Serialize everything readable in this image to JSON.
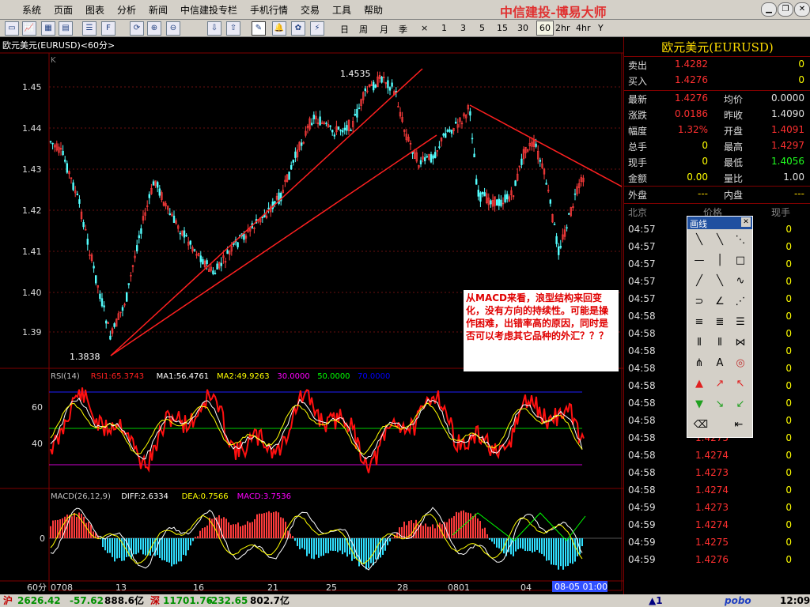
{
  "menu": {
    "items": [
      "系统",
      "页面",
      "图表",
      "分析",
      "新闻",
      "中信建投专栏",
      "手机行情",
      "交易",
      "工具",
      "帮助"
    ],
    "brand": "中信建投-博易大师"
  },
  "window_controls": [
    "minimize",
    "restore",
    "close"
  ],
  "toolbar": {
    "icons": [
      "new-window-icon",
      "line-chart-icon",
      "indicator-icon",
      "table-icon",
      "list-icon",
      "f10-icon",
      "refresh-icon",
      "zoom-in-icon",
      "zoom-out-icon",
      "export-icon",
      "import-icon",
      "draw-tool-icon",
      "alert-bell-icon",
      "colors-icon",
      "lightning-icon"
    ],
    "periods": [
      "日",
      "周",
      "月",
      "季",
      "×",
      "1",
      "3",
      "5",
      "15",
      "30",
      "60",
      "2hr",
      "4hr",
      "Y"
    ],
    "active_period": "60"
  },
  "chart": {
    "title": "欧元美元(EURUSD)<60分>",
    "price_label": "K",
    "price_ticks": [
      "1.45",
      "1.44",
      "1.43",
      "1.42",
      "1.41",
      "1.40",
      "1.39"
    ],
    "high_label": "1.4535",
    "low_label": "1.3838",
    "rsi": {
      "header": [
        {
          "text": "RSI(14)",
          "color": "#c0c0c0"
        },
        {
          "text": "RSI1:65.3743",
          "color": "#ff2020"
        },
        {
          "text": "MA1:56.4761",
          "color": "#ffffff"
        },
        {
          "text": "MA2:49.9263",
          "color": "#ffff00"
        },
        {
          "text": "30.0000",
          "color": "#ff00ff"
        },
        {
          "text": "50.0000",
          "color": "#00ff00"
        },
        {
          "text": "70.0000",
          "color": "#0000ff"
        }
      ],
      "ticks": [
        "60",
        "40"
      ]
    },
    "macd": {
      "header": [
        {
          "text": "MACD(26,12,9)",
          "color": "#c0c0c0"
        },
        {
          "text": "DIFF:2.6334",
          "color": "#ffffff"
        },
        {
          "text": "DEA:0.7566",
          "color": "#ffff00"
        },
        {
          "text": "MACD:3.7536",
          "color": "#ff00ff"
        }
      ],
      "ticks": [
        "0"
      ]
    },
    "period_label": "60分",
    "x_labels": [
      "0708",
      "13",
      "16",
      "21",
      "25",
      "28",
      "0801",
      "04"
    ],
    "cursor_time": "08-05 01:00",
    "annotation": "从MACD来看，浪型结构来回变化，没有方向的持续性。可能是操作困难，出错率高的原因，同时是否可以考虑其它品种的外汇？？？"
  },
  "quote": {
    "title": "欧元美元(EURUSD)",
    "rows_top": [
      {
        "label": "卖出",
        "value": "1.4282",
        "value_color": "#ff3030",
        "vol": "0"
      },
      {
        "label": "买入",
        "value": "1.4276",
        "value_color": "#ff3030",
        "vol": "0"
      }
    ],
    "rows_main": [
      {
        "l1": "最新",
        "v1": "1.4276",
        "c1": "#ff3030",
        "l2": "均价",
        "v2": "0.0000",
        "c2": "#e0e0e0"
      },
      {
        "l1": "涨跌",
        "v1": "0.0186",
        "c1": "#ff3030",
        "l2": "昨收",
        "v2": "1.4090",
        "c2": "#e0e0e0"
      },
      {
        "l1": "幅度",
        "v1": "1.32%",
        "c1": "#ff3030",
        "l2": "开盘",
        "v2": "1.4091",
        "c2": "#ff3030"
      },
      {
        "l1": "总手",
        "v1": "0",
        "c1": "#ffff00",
        "l2": "最高",
        "v2": "1.4297",
        "c2": "#ff3030"
      },
      {
        "l1": "现手",
        "v1": "0",
        "c1": "#ffff00",
        "l2": "最低",
        "v2": "1.4056",
        "c2": "#20ff20"
      },
      {
        "l1": "金额",
        "v1": "0.00",
        "c1": "#ffff00",
        "l2": "量比",
        "v2": "1.00",
        "c2": "#e0e0e0"
      }
    ],
    "outer_label": "外盘",
    "outer_value": "---",
    "inner_label": "内盘",
    "inner_value": "---",
    "trade_header": {
      "time": "北京",
      "price": "价格",
      "vol": "现手"
    },
    "trades": [
      {
        "time": "04:57",
        "price": "",
        "vol": "0"
      },
      {
        "time": "04:57",
        "price": "",
        "vol": "0"
      },
      {
        "time": "04:57",
        "price": "",
        "vol": "0"
      },
      {
        "time": "04:57",
        "price": "",
        "vol": "0"
      },
      {
        "time": "04:57",
        "price": "",
        "vol": "0"
      },
      {
        "time": "04:58",
        "price": "",
        "vol": "0"
      },
      {
        "time": "04:58",
        "price": "",
        "vol": "0"
      },
      {
        "time": "04:58",
        "price": "",
        "vol": "0"
      },
      {
        "time": "04:58",
        "price": "",
        "vol": "0"
      },
      {
        "time": "04:58",
        "price": "",
        "vol": "0"
      },
      {
        "time": "04:58",
        "price": "",
        "vol": "0"
      },
      {
        "time": "04:58",
        "price": "1.4276",
        "vol": "0"
      },
      {
        "time": "04:58",
        "price": "1.4275",
        "vol": "0"
      },
      {
        "time": "04:58",
        "price": "1.4274",
        "vol": "0"
      },
      {
        "time": "04:58",
        "price": "1.4273",
        "vol": "0"
      },
      {
        "time": "04:58",
        "price": "1.4274",
        "vol": "0"
      },
      {
        "time": "04:59",
        "price": "1.4273",
        "vol": "0"
      },
      {
        "time": "04:59",
        "price": "1.4274",
        "vol": "0"
      },
      {
        "time": "04:59",
        "price": "1.4275",
        "vol": "0"
      },
      {
        "time": "04:59",
        "price": "1.4276",
        "vol": "0"
      }
    ]
  },
  "drawing_tools": {
    "title": "画线",
    "tools": [
      {
        "name": "line-down-tool-icon",
        "glyph": "╲"
      },
      {
        "name": "line-down-steep-tool-icon",
        "glyph": "╲"
      },
      {
        "name": "double-line-tool-icon",
        "glyph": "⋱"
      },
      {
        "name": "horizontal-line-tool-icon",
        "glyph": "—"
      },
      {
        "name": "vertical-line-tool-icon",
        "glyph": "│"
      },
      {
        "name": "rectangle-tool-icon",
        "glyph": "□"
      },
      {
        "name": "ray-tool-icon",
        "glyph": "╱"
      },
      {
        "name": "segment-tool-icon",
        "glyph": "╲"
      },
      {
        "name": "wave-tool-icon",
        "glyph": "∿"
      },
      {
        "name": "arc-tool-icon",
        "glyph": "⊃"
      },
      {
        "name": "angle-tool-icon",
        "glyph": "∠"
      },
      {
        "name": "fan-tool-icon",
        "glyph": "⋰"
      },
      {
        "name": "channel-tool-icon",
        "glyph": "≡"
      },
      {
        "name": "parallel-tool-icon",
        "glyph": "≣"
      },
      {
        "name": "fibonacci-tool-icon",
        "glyph": "☰"
      },
      {
        "name": "time-cycle-tool-icon",
        "glyph": "⦀"
      },
      {
        "name": "period-lines-tool-icon",
        "glyph": "⦀"
      },
      {
        "name": "gann-tool-icon",
        "glyph": "⋈"
      },
      {
        "name": "pitchfork-tool-icon",
        "glyph": "⋔"
      },
      {
        "name": "text-tool-icon",
        "glyph": "A"
      },
      {
        "name": "target-tool-icon",
        "glyph": "◎"
      },
      {
        "name": "up-arrow-tool-icon",
        "glyph": "▲"
      },
      {
        "name": "up-right-arrow-tool-icon",
        "glyph": "↗"
      },
      {
        "name": "up-left-arrow-tool-icon",
        "glyph": "↖"
      },
      {
        "name": "down-arrow-tool-icon",
        "glyph": "▼"
      },
      {
        "name": "down-right-arrow-tool-icon",
        "glyph": "↘"
      },
      {
        "name": "down-left-arrow-tool-icon",
        "glyph": "↙"
      },
      {
        "name": "eraser-tool-icon",
        "glyph": "⌫"
      },
      {
        "name": "delete-tool-icon",
        "glyph": "⇤"
      }
    ]
  },
  "status": {
    "sh_label": "沪",
    "sh_index": "2626.42",
    "sh_change": "-57.62",
    "sh_amount": "888.6亿",
    "sz_label": "深",
    "sz_index": "11701.76",
    "sz_change": "-232.65",
    "sz_amount": "802.7亿",
    "alert": "▲1",
    "logo": "pobo",
    "clock": "12:09"
  }
}
